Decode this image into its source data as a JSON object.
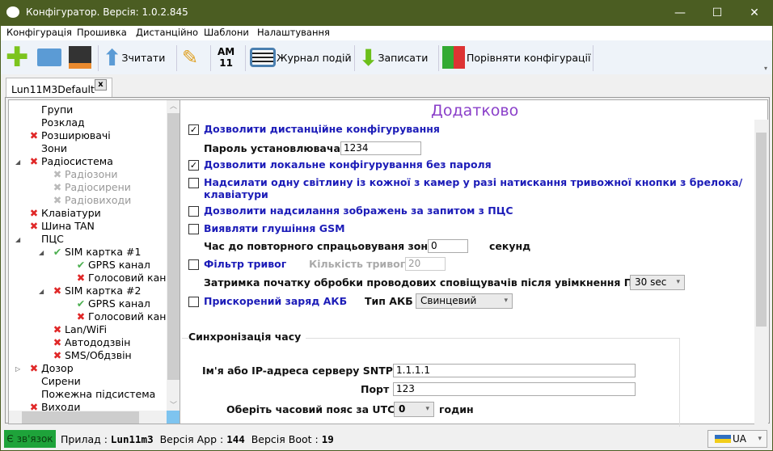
{
  "window": {
    "title": "Конфігуратор. Версія: 1.0.2.845"
  },
  "menu": [
    "Конфігурація",
    "Прошивка",
    "Дистанційно",
    "Шаблони",
    "Налаштування"
  ],
  "toolbar": {
    "read": "Зчитати",
    "am_top": "AM",
    "am_bottom": "11",
    "journal": "Журнал подій",
    "write": "Записати",
    "compare": "Порівняти конфігурації"
  },
  "tab": {
    "label": "Lun11M3Default",
    "close": "x"
  },
  "tree": [
    {
      "label": "Групи",
      "icon": "none",
      "level": 0
    },
    {
      "label": "Розклад",
      "icon": "none",
      "level": 0
    },
    {
      "label": "Розширювачі",
      "icon": "x",
      "level": 0
    },
    {
      "label": "Зони",
      "icon": "none",
      "level": 0
    },
    {
      "label": "Радіосистема",
      "icon": "x",
      "level": 0,
      "expander": "open"
    },
    {
      "label": "Радіозони",
      "icon": "xg",
      "level": 1,
      "disabled": true
    },
    {
      "label": "Радіосирени",
      "icon": "xg",
      "level": 1,
      "disabled": true
    },
    {
      "label": "Радіовиходи",
      "icon": "xg",
      "level": 1,
      "disabled": true
    },
    {
      "label": "Клавіатури",
      "icon": "x",
      "level": 0
    },
    {
      "label": "Шина TAN",
      "icon": "x",
      "level": 0
    },
    {
      "label": "ПЦС",
      "icon": "none",
      "level": 0,
      "expander": "open"
    },
    {
      "label": "SIM картка #1",
      "icon": "ok",
      "level": 1,
      "expander": "open"
    },
    {
      "label": "GPRS канал",
      "icon": "ok",
      "level": 2
    },
    {
      "label": "Голосовий канал",
      "icon": "x",
      "level": 2
    },
    {
      "label": "SIM картка #2",
      "icon": "x",
      "level": 1,
      "expander": "open"
    },
    {
      "label": "GPRS канал",
      "icon": "ok",
      "level": 2
    },
    {
      "label": "Голосовий канал",
      "icon": "x",
      "level": 2
    },
    {
      "label": "Lan/WiFi",
      "icon": "x",
      "level": 1
    },
    {
      "label": "Автододзвін",
      "icon": "x",
      "level": 1
    },
    {
      "label": "SMS/Обдзвін",
      "icon": "x",
      "level": 1
    },
    {
      "label": "Дозор",
      "icon": "x",
      "level": 0,
      "expander": "closed"
    },
    {
      "label": "Сирени",
      "icon": "none",
      "level": 0
    },
    {
      "label": "Пожежна підсистема",
      "icon": "none",
      "level": 0
    },
    {
      "label": "Виходи",
      "icon": "x",
      "level": 0
    }
  ],
  "main": {
    "title": "Додатково",
    "remote_config": {
      "label": "Дозволити дистанційне конфігурування",
      "checked": true
    },
    "installer_password": {
      "label": "Пароль установлювача",
      "value": "1234"
    },
    "local_config": {
      "label": "Дозволити локальне конфігурування без пароля",
      "checked": true
    },
    "send_photo": {
      "label_line1": "Надсилати одну світлину із кожної з камер у разі натискання тривожної кнопки з брелока/",
      "label_line2": "клавіатури",
      "checked": false
    },
    "allow_images": {
      "label": "Дозволити надсилання зображень за запитом з ПЦС",
      "checked": false
    },
    "gsm_jamming": {
      "label": "Виявляти глушіння GSM",
      "checked": false
    },
    "zone_retrigger": {
      "label": "Час до повторного спрацьовуваня зони",
      "value": "0",
      "unit": "секунд"
    },
    "alarm_filter": {
      "label": "Фільтр тривог",
      "checked": false,
      "count_label": "Кількість тривог",
      "count_value": "20"
    },
    "wired_delay": {
      "label": "Затримка початку обробки проводових сповіщувачів після увімкнення ППК",
      "value": "30 sec"
    },
    "fast_charge": {
      "label": "Прискорений заряд АКБ",
      "checked": false,
      "battery_type_label": "Тип АКБ",
      "battery_type": "Свинцевий"
    },
    "time_sync": {
      "title": "Синхронізація часу",
      "sntp_label": "Ім'я або IP-адреса серверу SNTP",
      "sntp_value": "1.1.1.1",
      "port_label": "Порт",
      "port_value": "123",
      "tz_label": "Оберіть часовий пояс за UTC",
      "tz_value": "0",
      "tz_unit": "годин"
    }
  },
  "status": {
    "connection": "Є зв'язок",
    "device_label": "Прилад :",
    "device": "Lun11m3",
    "app_label": "Версія App :",
    "app": "144",
    "boot_label": "Версія Boot :",
    "boot": "19",
    "language": "UA"
  }
}
